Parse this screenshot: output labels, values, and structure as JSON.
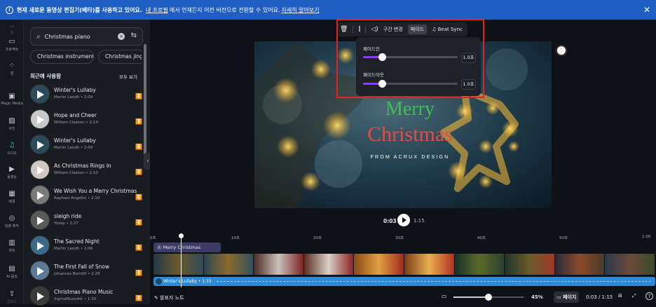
{
  "banner": {
    "lead": "현재 새로운 동영상 편집기(베타)를 사용하고 있어요.",
    "link1": "내 프로필",
    "mid": "에서 언제든지 이전 버전으로 전환할 수 있어요.",
    "link2": "자세히 알아보기"
  },
  "rail": [
    {
      "label": "홈",
      "icon": "home-icon"
    },
    {
      "label": "프로젝트",
      "icon": "folder-icon"
    },
    {
      "label": "앱",
      "icon": "apps-icon"
    },
    {
      "label": "Magic Media",
      "icon": "magic-media-icon"
    },
    {
      "label": "사진",
      "icon": "photo-icon"
    },
    {
      "label": "오디오",
      "icon": "music-icon"
    },
    {
      "label": "동영상",
      "icon": "video-icon"
    },
    {
      "label": "배경",
      "icon": "background-icon"
    },
    {
      "label": "대량 제작",
      "icon": "bulk-create-icon"
    },
    {
      "label": "차트",
      "icon": "chart-icon"
    },
    {
      "label": "AI 음성",
      "icon": "ai-voice-icon"
    },
    {
      "label": "업로드",
      "icon": "upload-icon"
    }
  ],
  "search": {
    "value": "Christmas piano"
  },
  "chips": [
    "Christmas instrumental",
    "Christmas jing"
  ],
  "recent": {
    "title": "최근에 사용함",
    "see_all": "모두 보기"
  },
  "tracks": [
    {
      "title": "Winter's Lullaby",
      "meta": "Martin Landh • 2:09"
    },
    {
      "title": "Hope and Cheer",
      "meta": "William Claeson • 2:14"
    },
    {
      "title": "Winter's Lullaby",
      "meta": "Martin Landh • 2:09"
    },
    {
      "title": "As Christmas Rings In",
      "meta": "William Claeson • 2:10"
    },
    {
      "title": "We Wish You a Merry Christmas",
      "meta": "Raphael Angelini • 2:10"
    },
    {
      "title": "sleigh ride",
      "meta": "Yosep • 2:27"
    },
    {
      "title": "The Sacred Night",
      "meta": "Martin Landh • 2:06"
    },
    {
      "title": "The First Fall of Snow",
      "meta": "Johannes Bornlöf • 2:29"
    },
    {
      "title": "Christmas Piano Music",
      "meta": "SigmaMusicArt • 1:30"
    }
  ],
  "toolbar": {
    "segment": "구간 변경",
    "fade": "페이드",
    "beat": "Beat Sync"
  },
  "fade_popup": {
    "fade_in_label": "페이드인",
    "fade_in_value": "1.0초",
    "fade_in_level": 0.2,
    "fade_out_label": "페이드아웃",
    "fade_out_value": "1.0초",
    "fade_out_level": 0.2
  },
  "video": {
    "line1": "Merry",
    "line2": "Christmas",
    "line3": "FROM ACRUX DESIGN"
  },
  "playback": {
    "current": "0:03",
    "total": "1:15"
  },
  "ruler": [
    "0초",
    "10초",
    "20초",
    "30초",
    "40초",
    "50초",
    "1:00"
  ],
  "timeline": {
    "text_clip": "Merry Christmas",
    "audio_clip": "Winter's Lullaby • 1:15"
  },
  "bottom": {
    "notes": "발표자 노트",
    "zoom": "45%",
    "pages": "페이지",
    "time": "0:03 / 1:15",
    "zoom_level": 0.5
  }
}
